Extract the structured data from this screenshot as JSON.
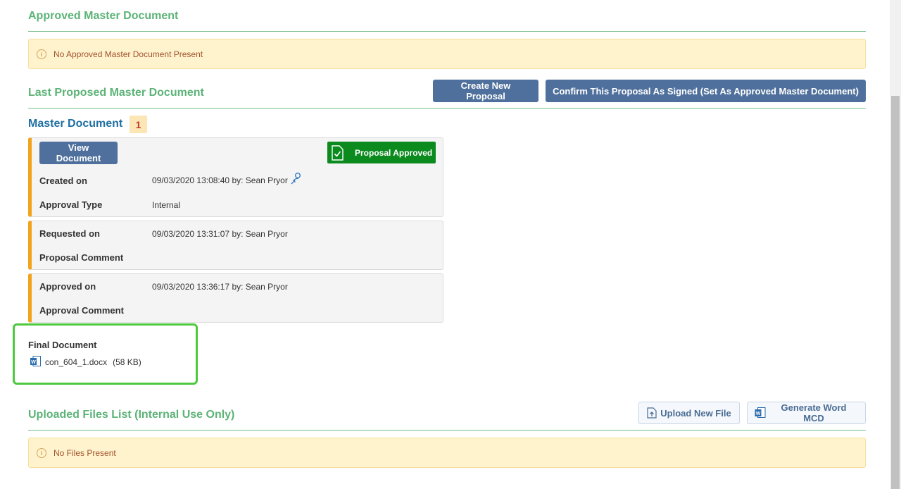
{
  "approved_section": {
    "title": "Approved Master Document",
    "alert": "No Approved Master Document Present"
  },
  "last_proposed_section": {
    "title": "Last Proposed Master Document",
    "create_button": "Create New Proposal",
    "confirm_button": "Confirm This Proposal As Signed (Set As Approved Master Document)"
  },
  "master_document": {
    "title": "Master Document",
    "badge": "1",
    "view_button": "View Document",
    "status_badge": "Proposal Approved",
    "created_label": "Created on",
    "created_value": "09/03/2020 13:08:40 by: Sean Pryor",
    "approval_type_label": "Approval Type",
    "approval_type_value": "Internal",
    "requested_label": "Requested on",
    "requested_value": "09/03/2020 13:31:07 by: Sean Pryor",
    "proposal_comment_label": "Proposal Comment",
    "approved_label": "Approved on",
    "approved_value": "09/03/2020 13:36:17 by: Sean Pryor",
    "approval_comment_label": "Approval Comment"
  },
  "final_document": {
    "title": "Final Document",
    "file_name": "con_604_1.docx",
    "file_size": "(58 KB)"
  },
  "uploaded_section": {
    "title": "Uploaded Files List (Internal Use Only)",
    "upload_button": "Upload New File",
    "generate_button": "Generate Word MCD",
    "alert": "No Files Present"
  },
  "icons": {
    "info": "info-circle-icon",
    "word": "word-file-icon",
    "signed_doc": "document-check-icon",
    "user_link": "user-link-icon",
    "upload": "upload-file-icon"
  },
  "colors": {
    "section_green": "#5cb377",
    "button_blue": "#4f709c",
    "approved_green": "#0b8a1e",
    "card_accent": "#f3a21b",
    "alert_bg": "#fff3cd",
    "highlight": "#4cc93e"
  }
}
